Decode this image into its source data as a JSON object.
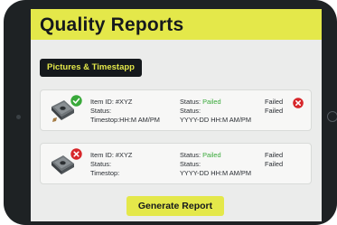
{
  "header": {
    "title": "Quality Reports"
  },
  "section": {
    "label": "Pictures & Timestapp"
  },
  "reports": [
    {
      "badge": "check",
      "item_id": "Item ID: #XYZ",
      "status_label": "Status:",
      "timestamp": "Timestop:HH:M AM/PM",
      "status_prefix": "Status:",
      "status_value": "Pailed",
      "status_line2": "Status:",
      "status_line3": "YYYY-DD HH:M AM/PM",
      "result_line1": "Failed",
      "result_line2": "Failed"
    },
    {
      "badge": "x",
      "item_id": "Item ID: #XYZ",
      "status_label": "Status:",
      "timestamp": "Timestop:",
      "status_prefix": "Status:",
      "status_value": "Pailed",
      "status_line2": "Status:",
      "status_line3": "YYYY-DD HH:M AM/PM",
      "result_line1": "Failed",
      "result_line2": "Failed"
    }
  ],
  "actions": {
    "generate_label": "Generate Report"
  },
  "colors": {
    "accent": "#e4e84a",
    "pass": "#39a93a",
    "fail": "#d7262a",
    "chip_bg": "#15191c"
  }
}
